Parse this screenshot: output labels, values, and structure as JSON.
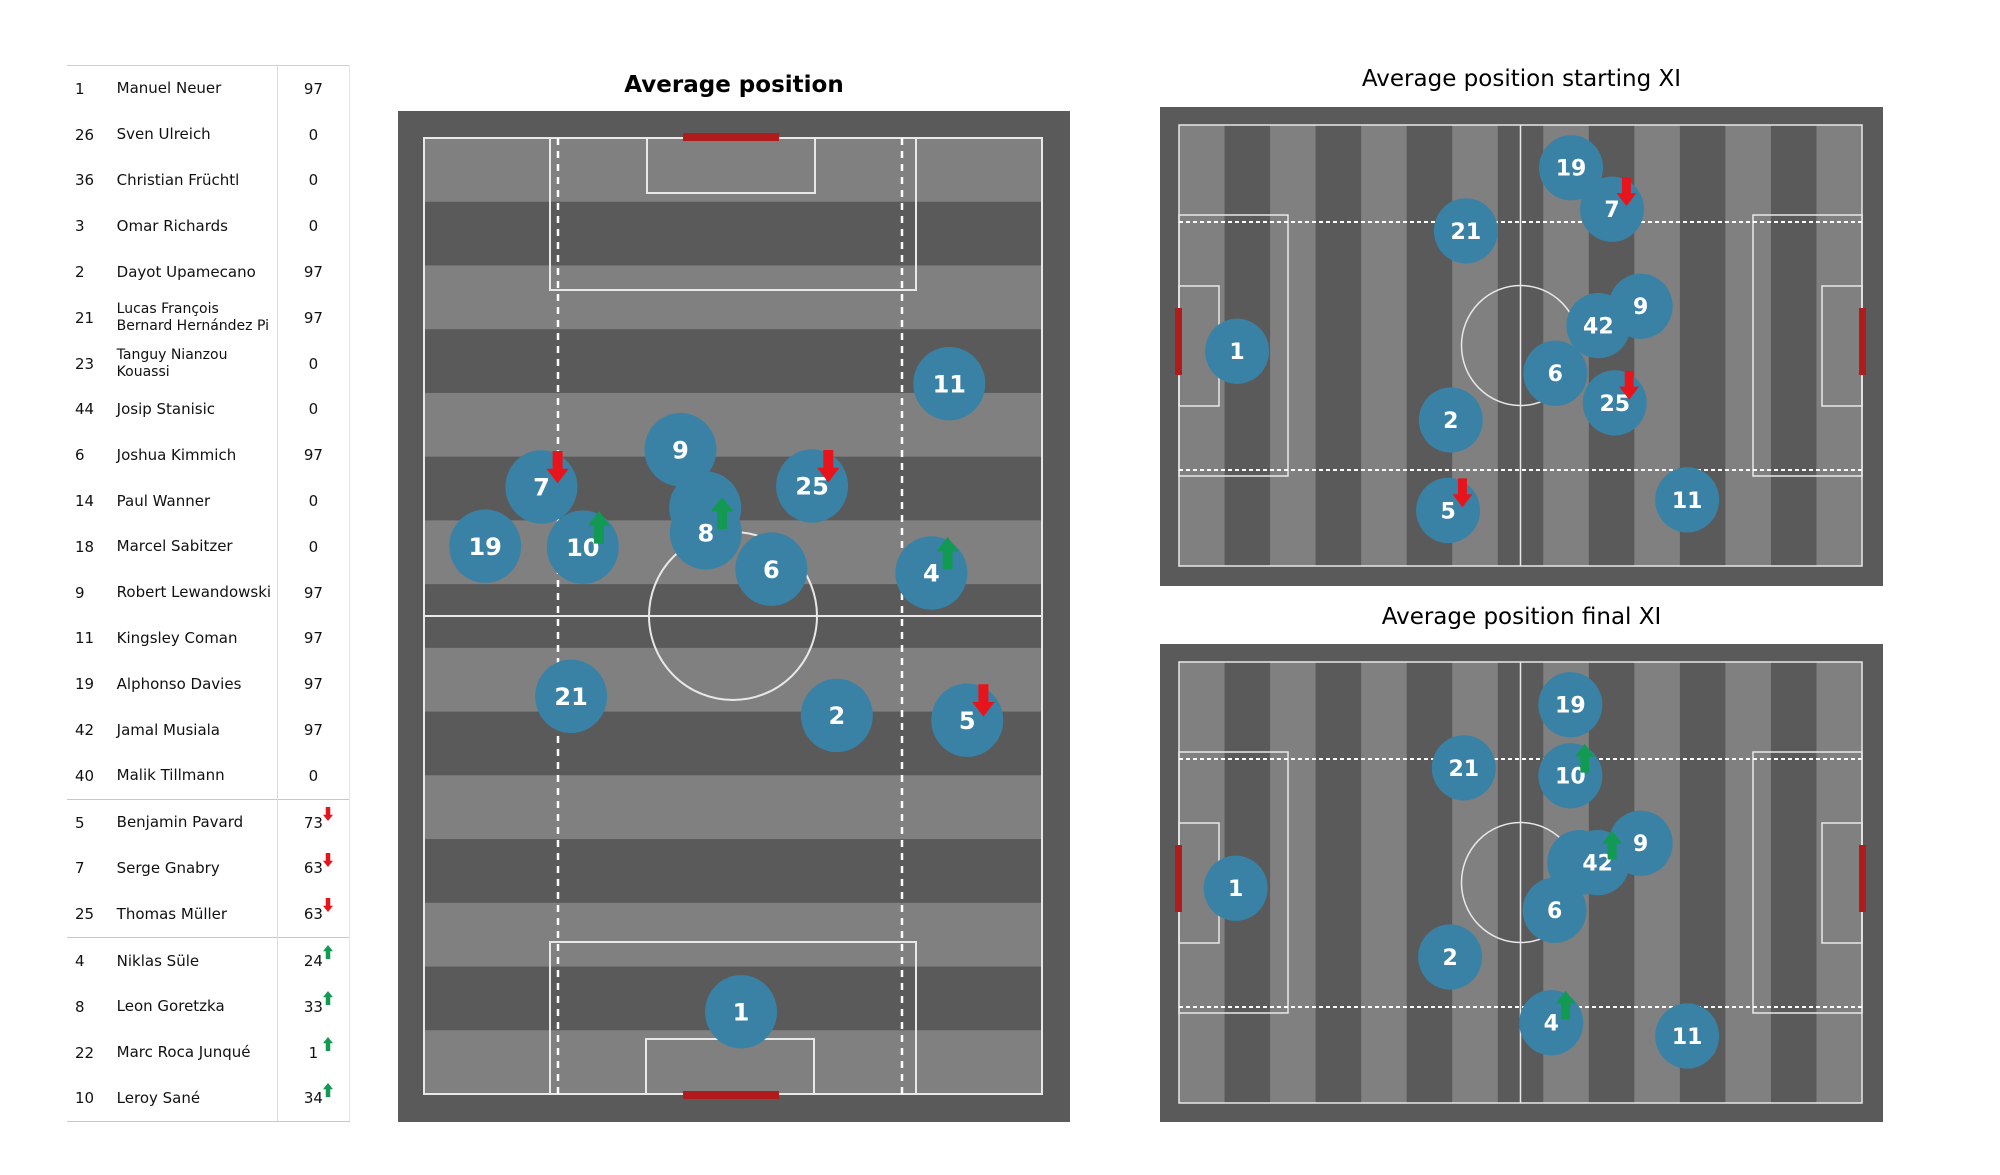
{
  "roster": {
    "groups": [
      {
        "kind": "lineup",
        "rows": [
          {
            "number": "1",
            "name": "Manuel Neuer",
            "minutes": "97"
          },
          {
            "number": "26",
            "name": "Sven Ulreich",
            "minutes": "0"
          },
          {
            "number": "36",
            "name": "Christian Früchtl",
            "minutes": "0"
          },
          {
            "number": "3",
            "name": "Omar Richards",
            "minutes": "0"
          },
          {
            "number": "2",
            "name": "Dayot Upamecano",
            "minutes": "97"
          },
          {
            "number": "21",
            "name": "Lucas François Bernard Hernández Pi",
            "minutes": "97"
          },
          {
            "number": "23",
            "name": "Tanguy Nianzou Kouassi",
            "minutes": "0"
          },
          {
            "number": "44",
            "name": "Josip Stanisic",
            "minutes": "0"
          },
          {
            "number": "6",
            "name": "Joshua Kimmich",
            "minutes": "97"
          },
          {
            "number": "14",
            "name": "Paul Wanner",
            "minutes": "0"
          },
          {
            "number": "18",
            "name": "Marcel Sabitzer",
            "minutes": "0"
          },
          {
            "number": "9",
            "name": "Robert Lewandowski",
            "minutes": "97"
          },
          {
            "number": "11",
            "name": "Kingsley Coman",
            "minutes": "97"
          },
          {
            "number": "19",
            "name": "Alphonso Davies",
            "minutes": "97"
          },
          {
            "number": "42",
            "name": "Jamal Musiala",
            "minutes": "97"
          },
          {
            "number": "40",
            "name": "Malik Tillmann",
            "minutes": "0"
          }
        ]
      },
      {
        "kind": "subbed-off",
        "rows": [
          {
            "number": "5",
            "name": "Benjamin Pavard",
            "minutes": "73",
            "sub": "off"
          },
          {
            "number": "7",
            "name": "Serge  Gnabry",
            "minutes": "63",
            "sub": "off"
          },
          {
            "number": "25",
            "name": "Thomas Müller",
            "minutes": "63",
            "sub": "off"
          }
        ]
      },
      {
        "kind": "subbed-on",
        "rows": [
          {
            "number": "4",
            "name": "Niklas Süle",
            "minutes": "24",
            "sub": "on"
          },
          {
            "number": "8",
            "name": "Leon  Goretzka",
            "minutes": "33",
            "sub": "on"
          },
          {
            "number": "22",
            "name": "Marc Roca Junqué",
            "minutes": "1",
            "sub": "on"
          },
          {
            "number": "10",
            "name": "Leroy Sané",
            "minutes": "34",
            "sub": "on"
          }
        ]
      }
    ]
  },
  "colors": {
    "player_marker": "#3a82a5",
    "pitch_light": "#808080",
    "pitch_dark": "#5a5a5a",
    "pitch_border": "#5a5a5a",
    "goal": "#b01c1c",
    "sub_off_arrow": "#e8141c",
    "sub_on_arrow": "#129a52",
    "lines": "#e8e8e8"
  },
  "chart_data": [
    {
      "type": "scatter",
      "title": "Average position",
      "orientation": "vertical",
      "xlim": [
        0,
        100
      ],
      "ylim": [
        0,
        100
      ],
      "players": [
        {
          "number": "11",
          "x": 85.0,
          "y": 25.7,
          "sub": null
        },
        {
          "number": "9",
          "x": 41.5,
          "y": 32.6,
          "sub": null
        },
        {
          "number": "7",
          "x": 19.0,
          "y": 36.5,
          "sub": "off"
        },
        {
          "number": "25",
          "x": 62.8,
          "y": 36.4,
          "sub": "off"
        },
        {
          "number": "42",
          "x": 45.5,
          "y": 38.7,
          "sub": null
        },
        {
          "number": "8",
          "x": 45.6,
          "y": 41.3,
          "sub": "on"
        },
        {
          "number": "19",
          "x": 9.9,
          "y": 42.7,
          "sub": null
        },
        {
          "number": "10",
          "x": 25.7,
          "y": 42.8,
          "sub": "on"
        },
        {
          "number": "6",
          "x": 56.2,
          "y": 45.1,
          "sub": null
        },
        {
          "number": "4",
          "x": 82.1,
          "y": 45.5,
          "sub": "on"
        },
        {
          "number": "21",
          "x": 23.8,
          "y": 58.4,
          "sub": null
        },
        {
          "number": "2",
          "x": 66.8,
          "y": 60.4,
          "sub": null
        },
        {
          "number": "5",
          "x": 87.9,
          "y": 60.9,
          "sub": "off"
        },
        {
          "number": "1",
          "x": 51.3,
          "y": 91.4,
          "sub": null
        }
      ]
    },
    {
      "type": "scatter",
      "title": "Average position starting XI",
      "orientation": "horizontal",
      "xlim": [
        0,
        100
      ],
      "ylim": [
        0,
        100
      ],
      "players": [
        {
          "number": "19",
          "x": 57.4,
          "y": 9.7,
          "sub": null
        },
        {
          "number": "7",
          "x": 63.4,
          "y": 19.1,
          "sub": "off"
        },
        {
          "number": "21",
          "x": 42.0,
          "y": 24.0,
          "sub": null
        },
        {
          "number": "9",
          "x": 67.6,
          "y": 41.1,
          "sub": null
        },
        {
          "number": "42",
          "x": 61.4,
          "y": 45.5,
          "sub": null
        },
        {
          "number": "1",
          "x": 8.5,
          "y": 51.3,
          "sub": null
        },
        {
          "number": "6",
          "x": 55.1,
          "y": 56.3,
          "sub": null
        },
        {
          "number": "25",
          "x": 63.8,
          "y": 63.0,
          "sub": "off"
        },
        {
          "number": "2",
          "x": 39.8,
          "y": 66.9,
          "sub": null
        },
        {
          "number": "11",
          "x": 74.4,
          "y": 85.0,
          "sub": null
        },
        {
          "number": "5",
          "x": 39.4,
          "y": 87.4,
          "sub": "off"
        }
      ]
    },
    {
      "type": "scatter",
      "title": "Average position final XI",
      "orientation": "horizontal",
      "xlim": [
        0,
        100
      ],
      "ylim": [
        0,
        100
      ],
      "players": [
        {
          "number": "19",
          "x": 57.3,
          "y": 9.7,
          "sub": null
        },
        {
          "number": "21",
          "x": 41.7,
          "y": 24.0,
          "sub": null
        },
        {
          "number": "10",
          "x": 57.3,
          "y": 25.8,
          "sub": "on"
        },
        {
          "number": "9",
          "x": 67.6,
          "y": 41.1,
          "sub": null
        },
        {
          "number": "8",
          "x": 58.6,
          "y": 45.5,
          "sub": null
        },
        {
          "number": "42",
          "x": 61.3,
          "y": 45.5,
          "sub": "on"
        },
        {
          "number": "1",
          "x": 8.3,
          "y": 51.3,
          "sub": null
        },
        {
          "number": "6",
          "x": 55.0,
          "y": 56.3,
          "sub": null
        },
        {
          "number": "2",
          "x": 39.7,
          "y": 66.9,
          "sub": null
        },
        {
          "number": "4",
          "x": 54.5,
          "y": 81.8,
          "sub": "on"
        },
        {
          "number": "11",
          "x": 74.4,
          "y": 84.8,
          "sub": null
        }
      ]
    }
  ]
}
